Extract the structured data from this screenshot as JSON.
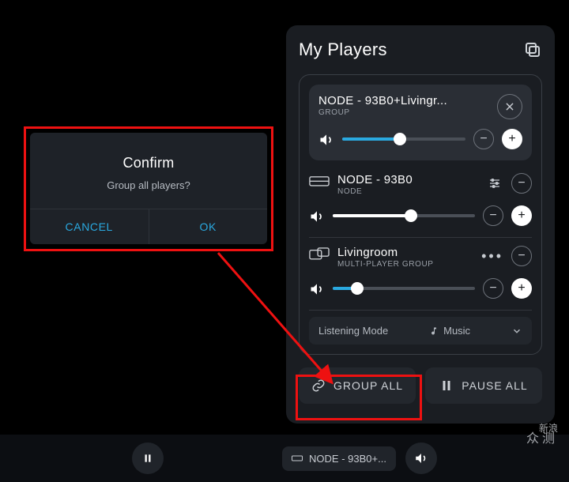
{
  "panel": {
    "title": "My Players",
    "group": {
      "name": "NODE - 93B0+Livingr...",
      "sub": "GROUP",
      "vol_percent": 47,
      "vol_color": "#2aa9e0"
    },
    "players": [
      {
        "name": "NODE - 93B0",
        "sub": "NODE",
        "icon": "device-node",
        "vol_percent": 55,
        "vol_color": "#ffffff",
        "controls": "eq-minus"
      },
      {
        "name": "Livingroom",
        "sub": "Multi-player Group",
        "icon": "device-group",
        "vol_percent": 17,
        "vol_color": "#2aa9e0",
        "controls": "dots-minus"
      }
    ],
    "listening": {
      "label": "Listening Mode",
      "mode": "Music"
    },
    "buttons": {
      "group_all": "GROUP ALL",
      "pause_all": "PAUSE ALL"
    }
  },
  "dialog": {
    "title": "Confirm",
    "message": "Group all players?",
    "cancel": "CANCEL",
    "ok": "OK"
  },
  "bottombar": {
    "now_playing": "NODE - 93B0+..."
  },
  "watermark": {
    "a": "新浪",
    "b": "众测"
  }
}
